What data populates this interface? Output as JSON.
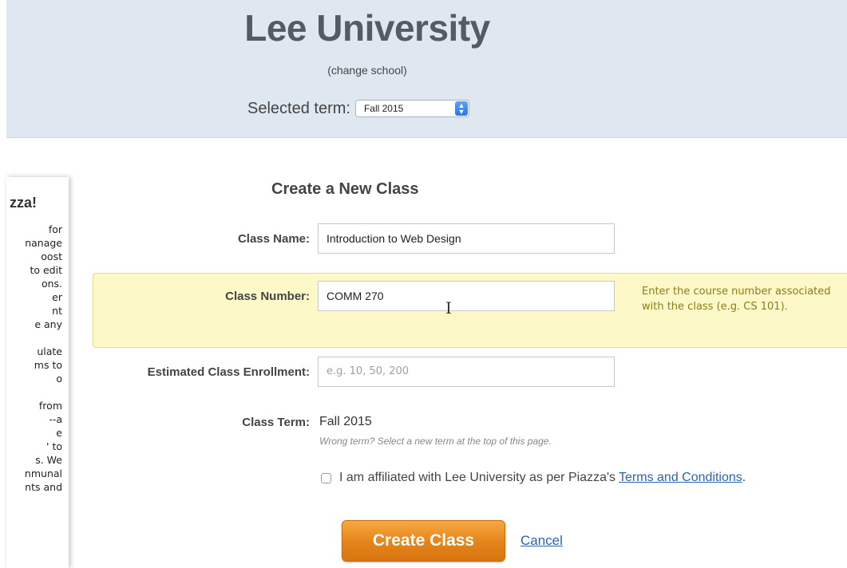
{
  "header": {
    "school_name": "Lee University",
    "change_school": "(change school)",
    "term_label": "Selected term:",
    "term_selected": "Fall 2015"
  },
  "left_panel": {
    "title": "zza!",
    "lines": [
      "for",
      "nanage",
      "oost",
      "to edit",
      "ons.",
      "er",
      "nt",
      "e any",
      "",
      "ulate",
      "ms to",
      "o",
      "",
      "from",
      "--a",
      "e",
      "' to",
      "s. We",
      "nmunal",
      "nts and"
    ]
  },
  "form": {
    "title": "Create a New Class",
    "class_name_label": "Class Name:",
    "class_name_value": "Introduction to Web Design",
    "class_number_label": "Class Number:",
    "class_number_value": "COMM 270",
    "class_number_hint": "Enter the course number associated with the class (e.g. CS 101).",
    "enrollment_label": "Estimated Class Enrollment:",
    "enrollment_placeholder": "e.g. 10, 50, 200",
    "term_label": "Class Term:",
    "term_value": "Fall 2015",
    "term_note": "Wrong term? Select a new term at the top of this page.",
    "agree_text": "I am affiliated with Lee University as per Piazza's",
    "agree_link": "Terms and Conditions",
    "agree_period": ".",
    "create_button": "Create Class",
    "cancel_link": "Cancel"
  },
  "colors": {
    "header_bg": "#dfe8f1",
    "highlight_bg": "#fdf8c8",
    "button_orange": "#e3841a",
    "link_blue": "#2864b4"
  }
}
